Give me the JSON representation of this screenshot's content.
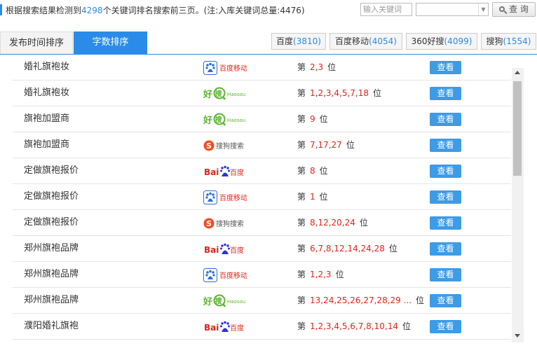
{
  "header": {
    "prefix": "根据搜索结果检测到",
    "keyword_count": "4298",
    "middle": "个关键词排名搜索前三页。",
    "note": "(注:入库关键词总量:4476)",
    "search_placeholder": "输入关键词",
    "engine_select_value": "",
    "query_label": "查 询"
  },
  "tabs": {
    "time_label": "发布时间排序",
    "count_label": "字数排序"
  },
  "engines": [
    {
      "name": "百度",
      "count": "(3810)"
    },
    {
      "name": "百度移动",
      "count": "(4054)"
    },
    {
      "name": "360好搜",
      "count": "(4099)"
    },
    {
      "name": "搜狗",
      "count": "(1554)"
    }
  ],
  "rows": [
    {
      "keyword": "婚礼旗袍妆",
      "engine": "baidu-mobile-logo",
      "rank_prefix": "第",
      "positions": "2,3",
      "rank_suffix": "位",
      "view_label": "查看"
    },
    {
      "keyword": "婚礼旗袍妆",
      "engine": "haosou-logo",
      "rank_prefix": "第",
      "positions": "1,2,3,4,5,7,18",
      "rank_suffix": "位",
      "view_label": "查看"
    },
    {
      "keyword": "旗袍加盟商",
      "engine": "haosou-logo",
      "rank_prefix": "第",
      "positions": "9",
      "rank_suffix": "位",
      "view_label": "查看"
    },
    {
      "keyword": "旗袍加盟商",
      "engine": "sogou-logo",
      "rank_prefix": "第",
      "positions": "7,17,27",
      "rank_suffix": "位",
      "view_label": "查看"
    },
    {
      "keyword": "定做旗袍报价",
      "engine": "baidu-logo",
      "rank_prefix": "第",
      "positions": "8",
      "rank_suffix": "位",
      "view_label": "查看"
    },
    {
      "keyword": "定做旗袍报价",
      "engine": "baidu-mobile-logo",
      "rank_prefix": "第",
      "positions": "1",
      "rank_suffix": "位",
      "view_label": "查看"
    },
    {
      "keyword": "定做旗袍报价",
      "engine": "sogou-logo",
      "rank_prefix": "第",
      "positions": "8,12,20,24",
      "rank_suffix": "位",
      "view_label": "查看"
    },
    {
      "keyword": "郑州旗袍品牌",
      "engine": "baidu-logo",
      "rank_prefix": "第",
      "positions": "6,7,8,12,14,24,28",
      "rank_suffix": "位",
      "view_label": "查看"
    },
    {
      "keyword": "郑州旗袍品牌",
      "engine": "baidu-mobile-logo",
      "rank_prefix": "第",
      "positions": "1,2,3",
      "rank_suffix": "位",
      "view_label": "查看"
    },
    {
      "keyword": "郑州旗袍品牌",
      "engine": "haosou-logo",
      "rank_prefix": "第",
      "positions": "13,24,25,26,27,28,29 ...",
      "rank_suffix": "位",
      "view_label": "查看"
    },
    {
      "keyword": "濮阳婚礼旗袍",
      "engine": "baidu-logo",
      "rank_prefix": "第",
      "positions": "1,2,3,4,5,6,7,8,10,14",
      "rank_suffix": "位",
      "view_label": "查看"
    }
  ],
  "logos": {
    "baidu_mobile_text": "百度移动",
    "haosou_cn": "好",
    "haosou_cn2": "搜",
    "haosou_en": "Haosou",
    "sogou_text": "搜狗搜索",
    "baidu_bai": "Bai",
    "baidu_cn": "百度"
  },
  "colors": {
    "accent": "#2a8ce8",
    "rank_red": "#e2231a",
    "button_blue": "#3e9be5"
  }
}
